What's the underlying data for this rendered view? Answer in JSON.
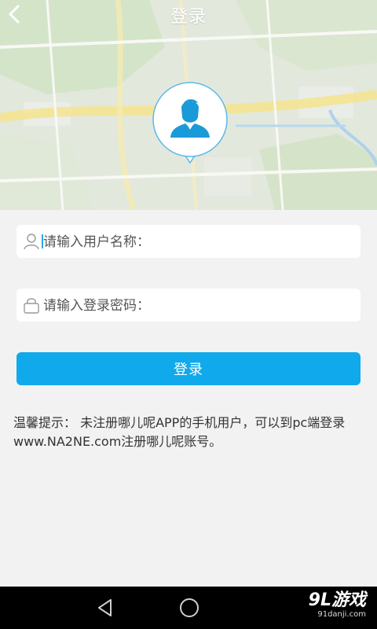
{
  "header": {
    "title": "登录",
    "back_icon": "chevron-left-icon",
    "avatar_icon": "user-silhouette-icon"
  },
  "form": {
    "username_placeholder": "请输入用户名称：",
    "username_icon": "user-outline-icon",
    "password_placeholder": "请输入登录密码：",
    "password_icon": "lock-icon",
    "login_label": "登录"
  },
  "tip": {
    "text": "温馨提示： 未注册哪儿呢APP的手机用户，可以到pc端登录www.NA2NE.com注册哪儿呢账号。"
  },
  "navbar": {
    "back_icon": "triangle-back-icon",
    "home_icon": "circle-home-icon"
  },
  "watermark": {
    "main": "9L游戏",
    "sub": "91danji.com"
  },
  "colors": {
    "accent": "#0fa9ec",
    "background": "#f2f2f2",
    "navbar": "#000000"
  }
}
